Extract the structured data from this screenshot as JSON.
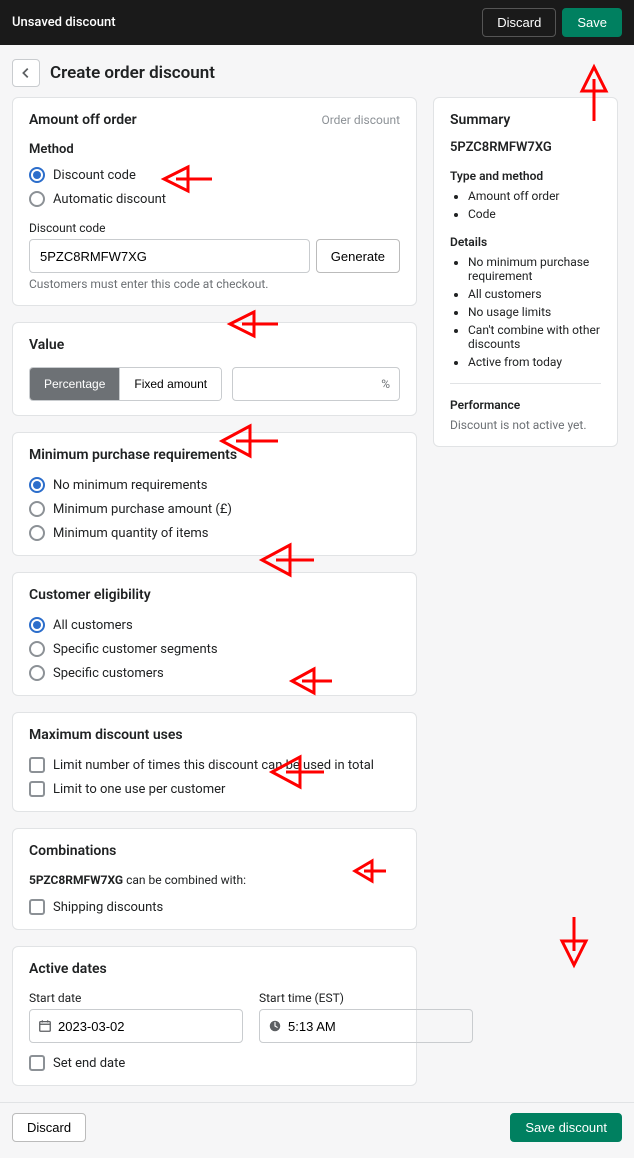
{
  "topbar": {
    "title": "Unsaved discount",
    "discard": "Discard",
    "save": "Save"
  },
  "page": {
    "title": "Create order discount"
  },
  "amount_off": {
    "title": "Amount off order",
    "type_label": "Order discount",
    "method_label": "Method",
    "opt_code": "Discount code",
    "opt_auto": "Automatic discount",
    "code_label": "Discount code",
    "code_value": "5PZC8RMFW7XG",
    "generate": "Generate",
    "help": "Customers must enter this code at checkout."
  },
  "value": {
    "title": "Value",
    "percentage": "Percentage",
    "fixed": "Fixed amount",
    "suffix": "%"
  },
  "min_purchase": {
    "title": "Minimum purchase requirements",
    "opt_none": "No minimum requirements",
    "opt_amount": "Minimum purchase amount (£)",
    "opt_qty": "Minimum quantity of items"
  },
  "eligibility": {
    "title": "Customer eligibility",
    "opt_all": "All customers",
    "opt_segments": "Specific customer segments",
    "opt_customers": "Specific customers"
  },
  "max_uses": {
    "title": "Maximum discount uses",
    "opt_total": "Limit number of times this discount can be used in total",
    "opt_one": "Limit to one use per customer"
  },
  "combinations": {
    "title": "Combinations",
    "text_code": "5PZC8RMFW7XG",
    "text_suffix": " can be combined with:",
    "opt_shipping": "Shipping discounts"
  },
  "active_dates": {
    "title": "Active dates",
    "start_date_label": "Start date",
    "start_time_label": "Start time (EST)",
    "start_date": "2023-03-02",
    "start_time": "5:13 AM",
    "set_end": "Set end date"
  },
  "summary": {
    "title": "Summary",
    "code": "5PZC8RMFW7XG",
    "type_method_label": "Type and method",
    "type_method": [
      "Amount off order",
      "Code"
    ],
    "details_label": "Details",
    "details": [
      "No minimum purchase requirement",
      "All customers",
      "No usage limits",
      "Can't combine with other discounts",
      "Active from today"
    ],
    "performance_label": "Performance",
    "performance_text": "Discount is not active yet."
  },
  "footer": {
    "discard": "Discard",
    "save": "Save discount"
  }
}
